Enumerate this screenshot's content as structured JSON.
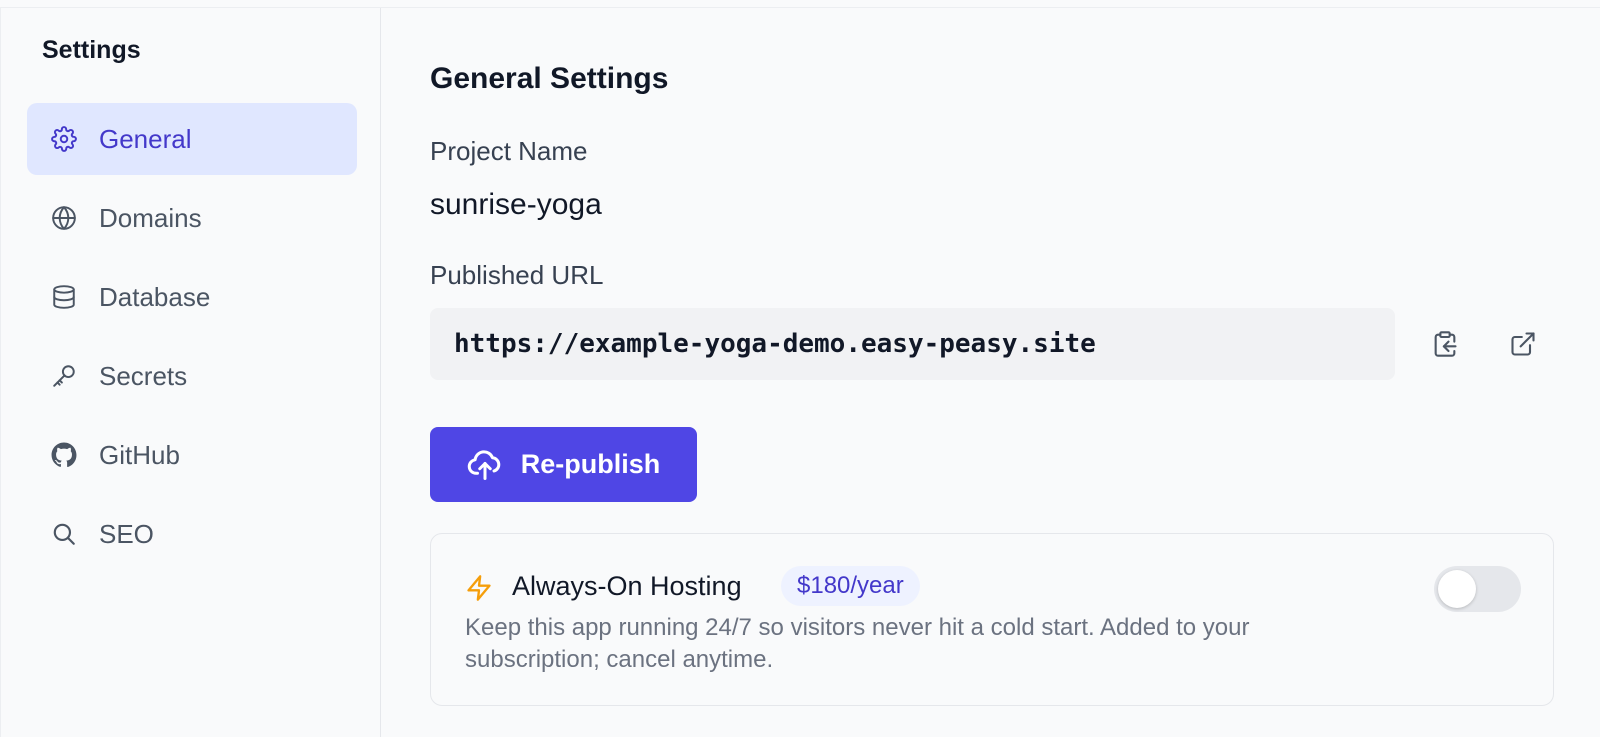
{
  "sidebar": {
    "title": "Settings",
    "items": [
      {
        "label": "General",
        "icon": "gear-icon",
        "active": true
      },
      {
        "label": "Domains",
        "icon": "globe-icon",
        "active": false
      },
      {
        "label": "Database",
        "icon": "database-icon",
        "active": false
      },
      {
        "label": "Secrets",
        "icon": "key-icon",
        "active": false
      },
      {
        "label": "GitHub",
        "icon": "github-icon",
        "active": false
      },
      {
        "label": "SEO",
        "icon": "search-icon",
        "active": false
      }
    ]
  },
  "main": {
    "title": "General Settings",
    "project_name_label": "Project Name",
    "project_name": "sunrise-yoga",
    "published_url_label": "Published URL",
    "published_url": "https://example-yoga-demo.easy-peasy.site",
    "copy_icon": "clipboard-copy-icon",
    "open_icon": "external-link-icon",
    "republish_label": "Re-publish",
    "hosting": {
      "title": "Always-On Hosting",
      "price": "$180/year",
      "description": "Keep this app running 24/7 so visitors never hit a cold start. Added to your subscription; cancel anytime.",
      "enabled": false
    }
  },
  "colors": {
    "accent": "#4f46e5",
    "active_nav_bg": "#e0e7ff",
    "active_nav_text": "#4338ca",
    "bolt": "#f59e0b"
  }
}
